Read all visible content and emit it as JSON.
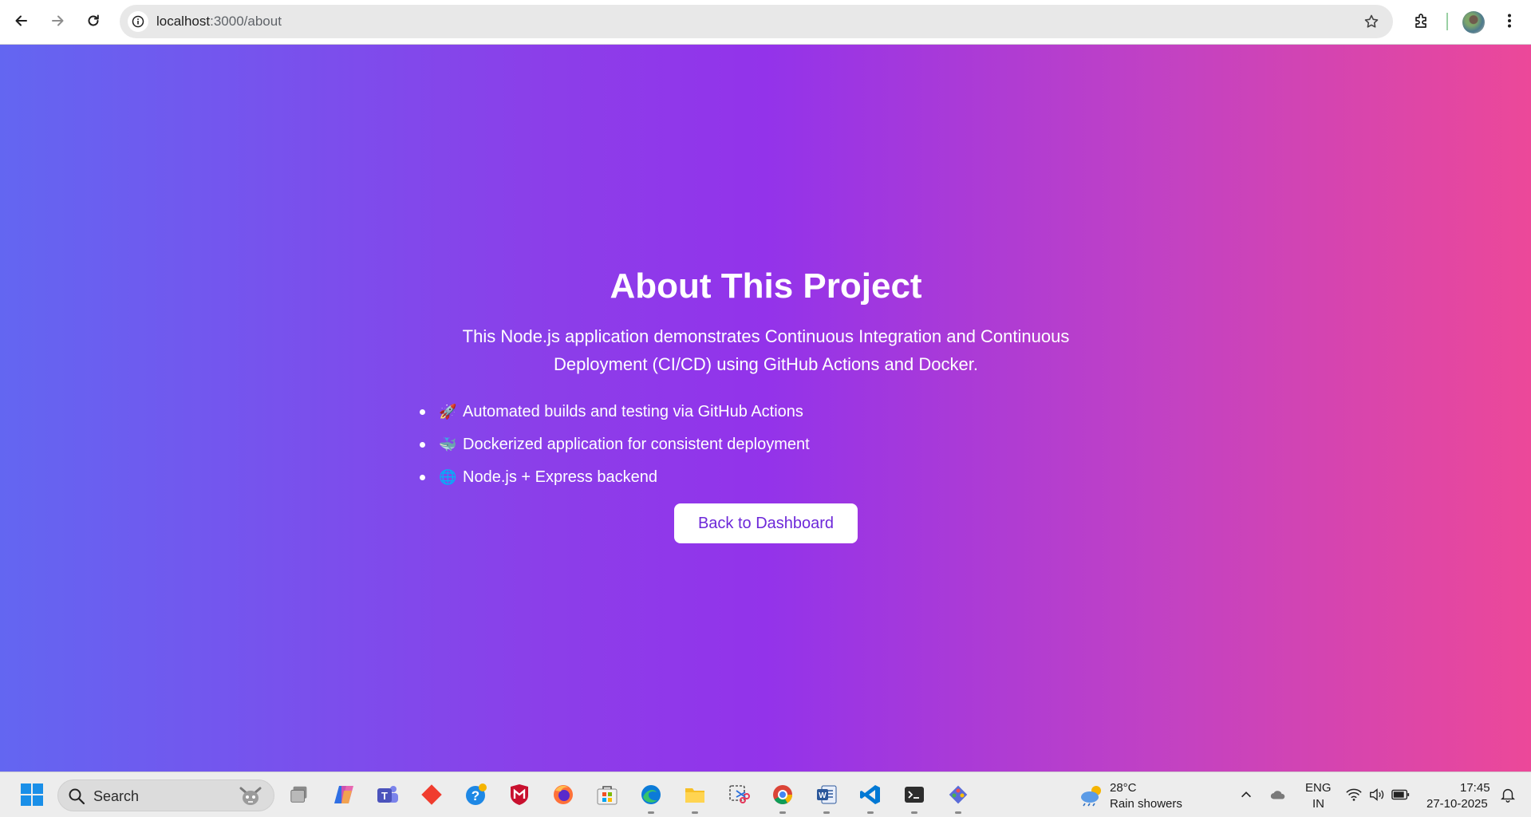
{
  "browser": {
    "url_host": "localhost",
    "url_path": ":3000/about"
  },
  "main": {
    "title": "About This Project",
    "description": "This Node.js application demonstrates Continuous Integration and Continuous Deployment (CI/CD) using GitHub Actions and Docker.",
    "features": [
      {
        "emoji": "🚀",
        "text": "Automated builds and testing via GitHub Actions"
      },
      {
        "emoji": "🐳",
        "text": "Dockerized application for consistent deployment"
      },
      {
        "emoji": "🌐",
        "text": "Node.js + Express backend"
      }
    ],
    "back_button": "Back to Dashboard"
  },
  "colors": {
    "gradient_start": "#6366f1",
    "gradient_mid": "#9333ea",
    "gradient_end": "#ec4899",
    "button_text": "#6d28d9"
  },
  "taskbar": {
    "search_label": "Search",
    "pinned_apps": [
      "task-view",
      "copilot",
      "teams",
      "git",
      "help",
      "mcafee",
      "firefox",
      "microsoft-store",
      "edge",
      "file-explorer",
      "snipping-tool",
      "chrome",
      "word",
      "vscode",
      "terminal",
      "gitkraken"
    ],
    "weather_temp": "28°C",
    "weather_desc": "Rain showers",
    "lang_top": "ENG",
    "lang_bottom": "IN",
    "time": "17:45",
    "date": "27-10-2025"
  }
}
